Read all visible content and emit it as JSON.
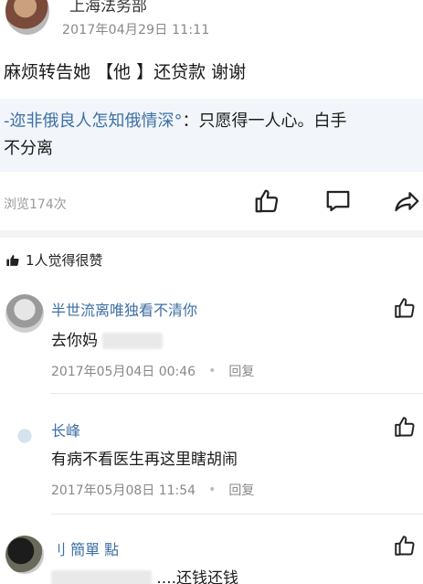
{
  "post": {
    "author": "上海法务部",
    "time": "2017年04月29日 11:11",
    "content": "麻烦转告她 【他 】还贷款 谢谢",
    "quoted": {
      "user": "-迩非俄良人怎知俄情深°",
      "separator": "：",
      "text_line1": "只愿得一人心。白手",
      "text_line2": "不分离"
    },
    "views": "浏览174次"
  },
  "icons": {
    "like": "thumbs-up-icon",
    "comment": "comment-bubble-icon",
    "share": "share-arrow-icon"
  },
  "likes_summary": "1人觉得很赞",
  "comments": [
    {
      "name": "半世流离唯独看不清你",
      "text": "去你妈",
      "time": "2017年05月04日 00:46",
      "reply": "回复"
    },
    {
      "name": "长峰",
      "text": "有病不看医生再这里瞎胡闹",
      "time": "2017年05月08日 11:54",
      "reply": "回复"
    },
    {
      "name": "刂 簡單 點",
      "text": "....还钱还钱"
    }
  ],
  "colors": {
    "link_blue": "#3d6fa6",
    "quoted_bg": "#f2f6fa",
    "meta_gray": "#888888"
  }
}
